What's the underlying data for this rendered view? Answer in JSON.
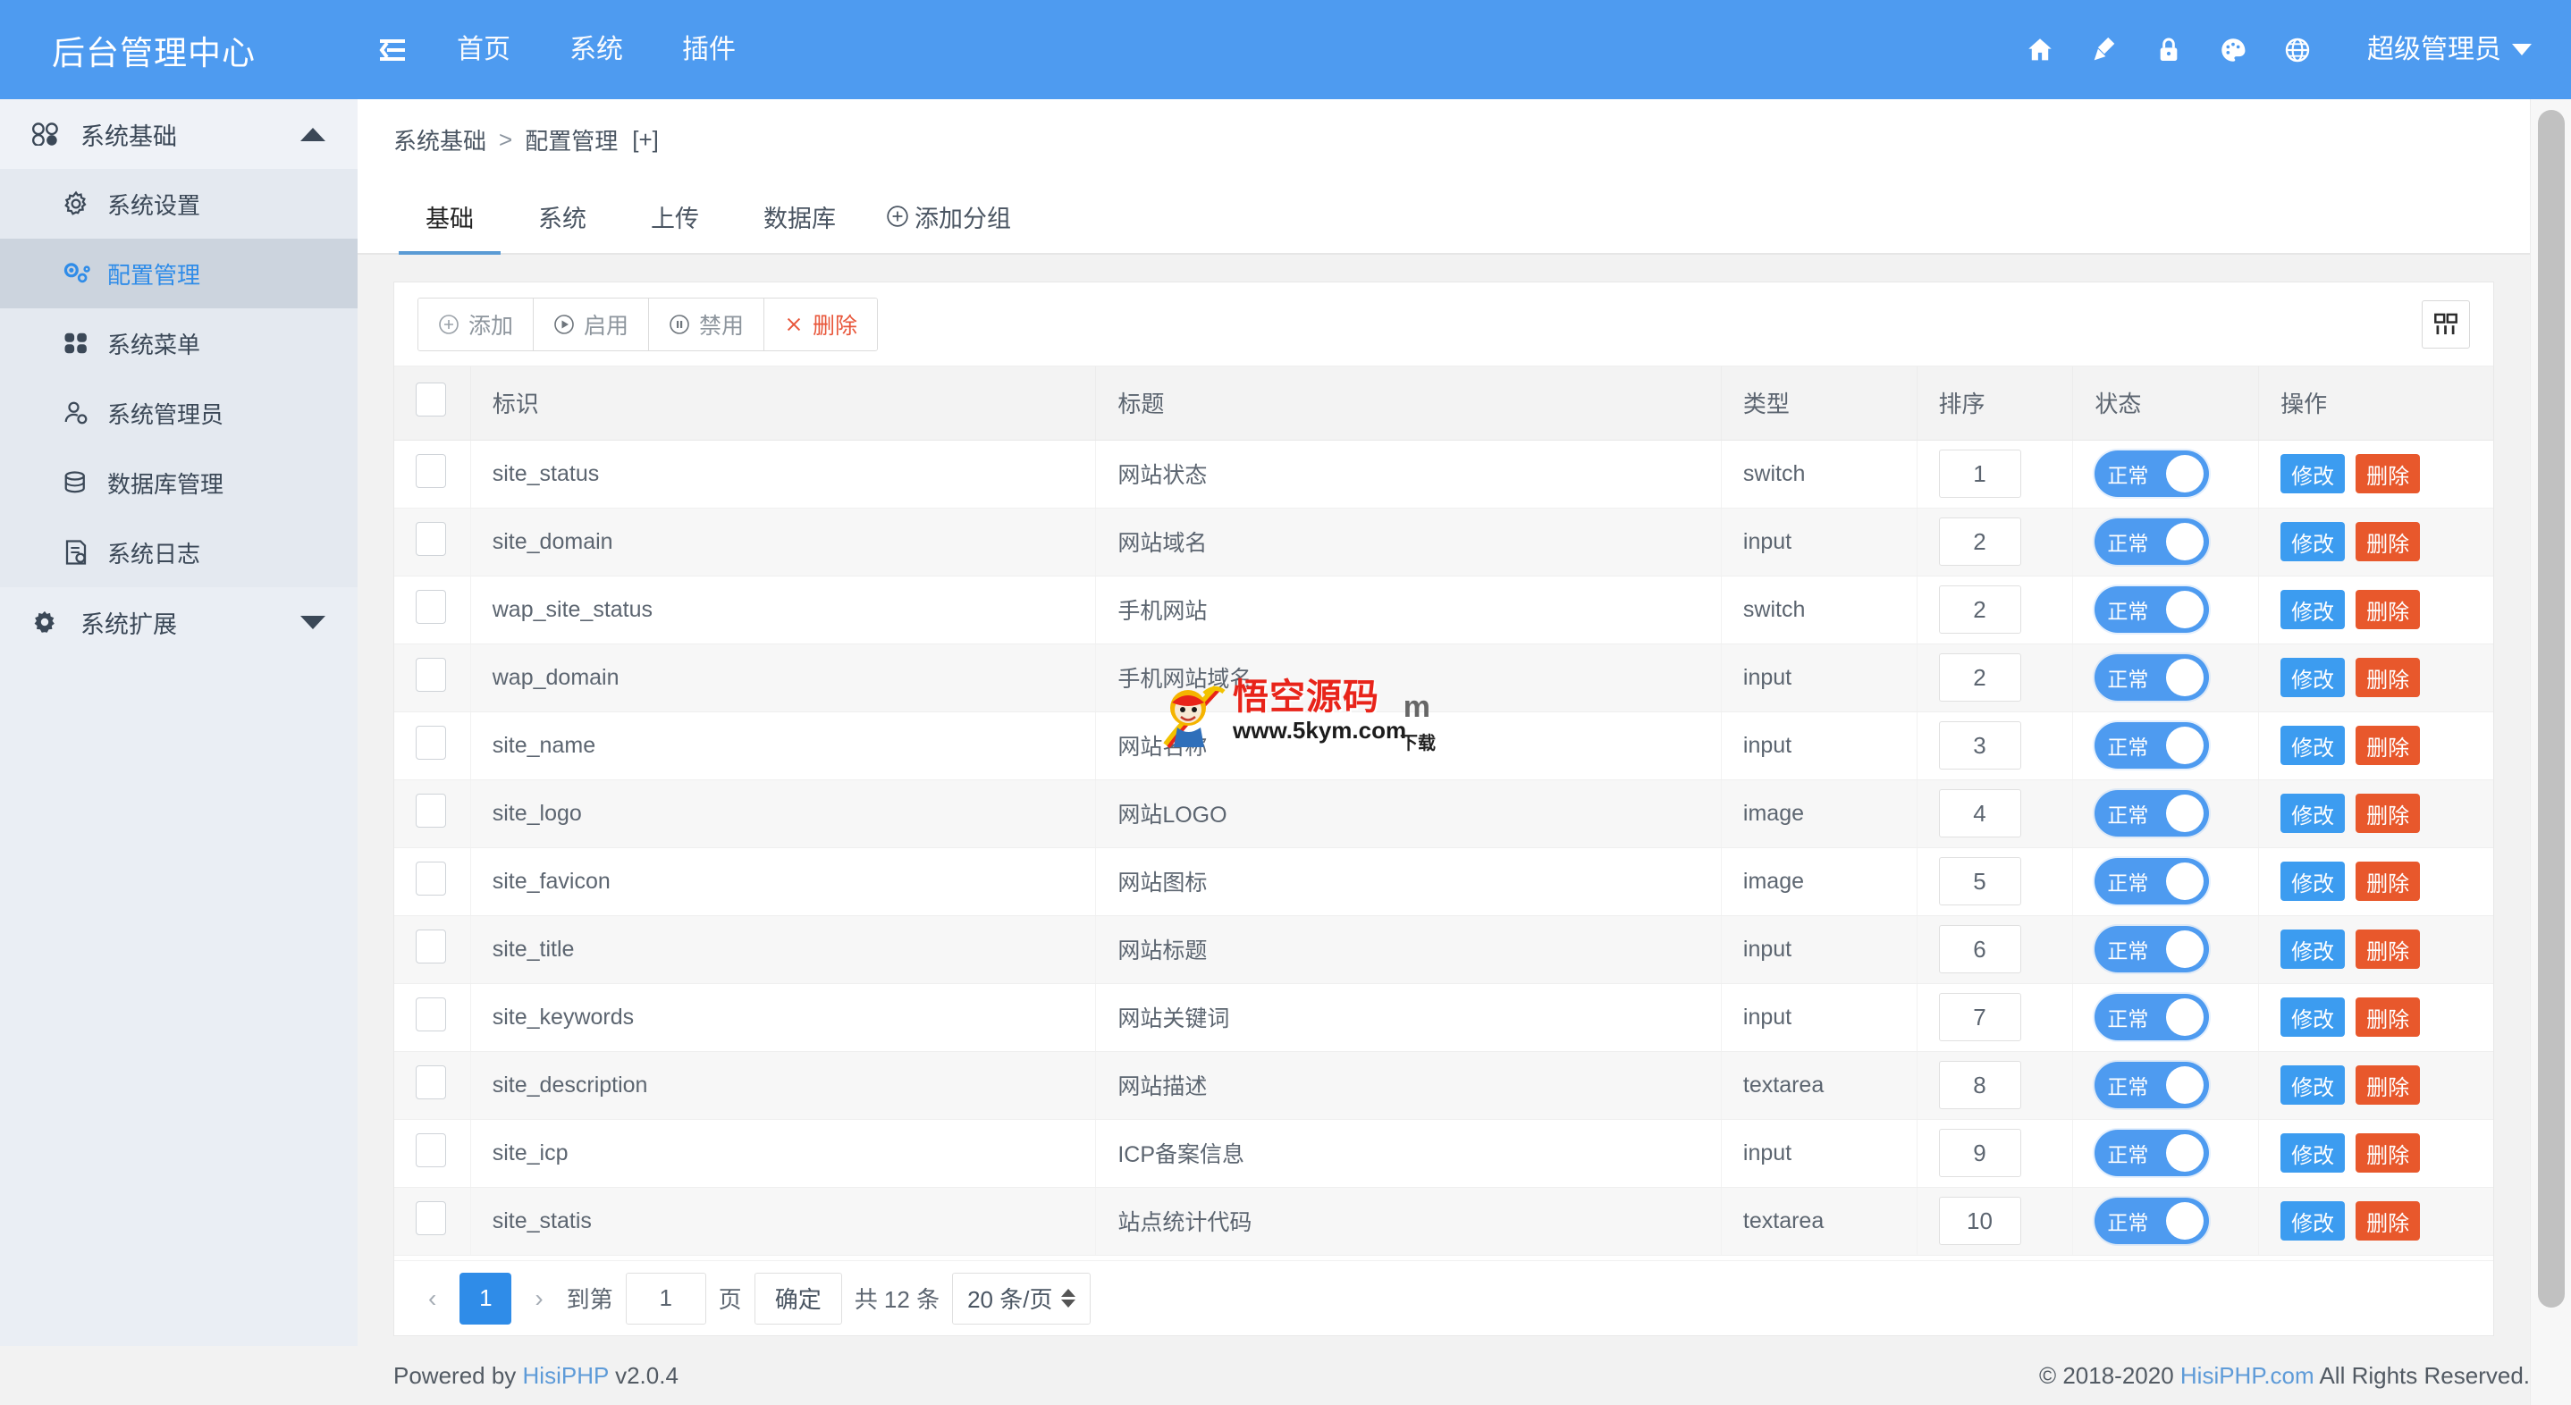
{
  "header": {
    "brand": "后台管理中心",
    "nav": [
      {
        "label": "首页"
      },
      {
        "label": "系统"
      },
      {
        "label": "插件"
      }
    ],
    "icons": [
      "home-icon",
      "broom-icon",
      "lock-icon",
      "palette-icon",
      "globe-icon"
    ],
    "user": "超级管理员"
  },
  "sidebar": {
    "groups": [
      {
        "label": "系统基础",
        "icon": "dots-icon",
        "expanded": true,
        "items": [
          {
            "label": "系统设置",
            "icon": "gear-icon",
            "active": false
          },
          {
            "label": "配置管理",
            "icon": "cogs-icon",
            "active": true
          },
          {
            "label": "系统菜单",
            "icon": "grid-icon",
            "active": false
          },
          {
            "label": "系统管理员",
            "icon": "user-gear-icon",
            "active": false
          },
          {
            "label": "数据库管理",
            "icon": "database-icon",
            "active": false
          },
          {
            "label": "系统日志",
            "icon": "log-icon",
            "active": false
          }
        ]
      },
      {
        "label": "系统扩展",
        "icon": "gear-icon",
        "expanded": false,
        "items": []
      }
    ]
  },
  "breadcrumb": {
    "root": "系统基础",
    "separator": ">",
    "current": "配置管理",
    "plus": "[+]"
  },
  "tabs": {
    "items": [
      {
        "label": "基础",
        "active": true
      },
      {
        "label": "系统",
        "active": false
      },
      {
        "label": "上传",
        "active": false
      },
      {
        "label": "数据库",
        "active": false
      }
    ],
    "add_label": "添加分组",
    "add_icon": "plus-circle-icon"
  },
  "toolbar": {
    "buttons": [
      {
        "label": "添加",
        "icon": "plus-circle-icon",
        "danger": false
      },
      {
        "label": "启用",
        "icon": "play-circle-icon",
        "danger": false
      },
      {
        "label": "禁用",
        "icon": "pause-circle-icon",
        "danger": false
      },
      {
        "label": "删除",
        "icon": "close-icon",
        "danger": true
      }
    ],
    "columns_icon": "columns-settings-icon"
  },
  "table": {
    "columns": [
      "标识",
      "标题",
      "类型",
      "排序",
      "状态",
      "操作"
    ],
    "op_edit": "修改",
    "op_delete": "删除",
    "status_label": "正常",
    "rows": [
      {
        "id": "site_status",
        "title": "网站状态",
        "type": "switch",
        "sort": "1",
        "status": "正常"
      },
      {
        "id": "site_domain",
        "title": "网站域名",
        "type": "input",
        "sort": "2",
        "status": "正常"
      },
      {
        "id": "wap_site_status",
        "title": "手机网站",
        "type": "switch",
        "sort": "2",
        "status": "正常"
      },
      {
        "id": "wap_domain",
        "title": "手机网站域名",
        "type": "input",
        "sort": "2",
        "status": "正常"
      },
      {
        "id": "site_name",
        "title": "网站名称",
        "type": "input",
        "sort": "3",
        "status": "正常"
      },
      {
        "id": "site_logo",
        "title": "网站LOGO",
        "type": "image",
        "sort": "4",
        "status": "正常"
      },
      {
        "id": "site_favicon",
        "title": "网站图标",
        "type": "image",
        "sort": "5",
        "status": "正常"
      },
      {
        "id": "site_title",
        "title": "网站标题",
        "type": "input",
        "sort": "6",
        "status": "正常"
      },
      {
        "id": "site_keywords",
        "title": "网站关键词",
        "type": "input",
        "sort": "7",
        "status": "正常"
      },
      {
        "id": "site_description",
        "title": "网站描述",
        "type": "textarea",
        "sort": "8",
        "status": "正常"
      },
      {
        "id": "site_icp",
        "title": "ICP备案信息",
        "type": "input",
        "sort": "9",
        "status": "正常"
      },
      {
        "id": "site_statis",
        "title": "站点统计代码",
        "type": "textarea",
        "sort": "10",
        "status": "正常"
      }
    ]
  },
  "pagination": {
    "prev": "‹",
    "current_page": "1",
    "next": "›",
    "goto_label": "到第",
    "goto_value": "1",
    "page_unit": "页",
    "confirm": "确定",
    "total_text": "共 12 条",
    "per_page": "20 条/页"
  },
  "footer": {
    "left_prefix": "Powered by ",
    "left_link": "HisiPHP",
    "left_suffix": " v2.0.4",
    "right_prefix": "© 2018-2020 ",
    "right_link": "HisiPHP.com",
    "right_suffix": " All Rights Reserved."
  },
  "watermark": {
    "cn": "悟空源码",
    "url": "www.5kym.com",
    "m": "m",
    "download": "下载"
  },
  "colors": {
    "primary": "#4e9bf0",
    "edit": "#3c9cf0",
    "delete": "#e8582c",
    "danger_text": "#e8563a",
    "active_sidebar": "#ccd4de",
    "link": "#5e9bd8"
  }
}
